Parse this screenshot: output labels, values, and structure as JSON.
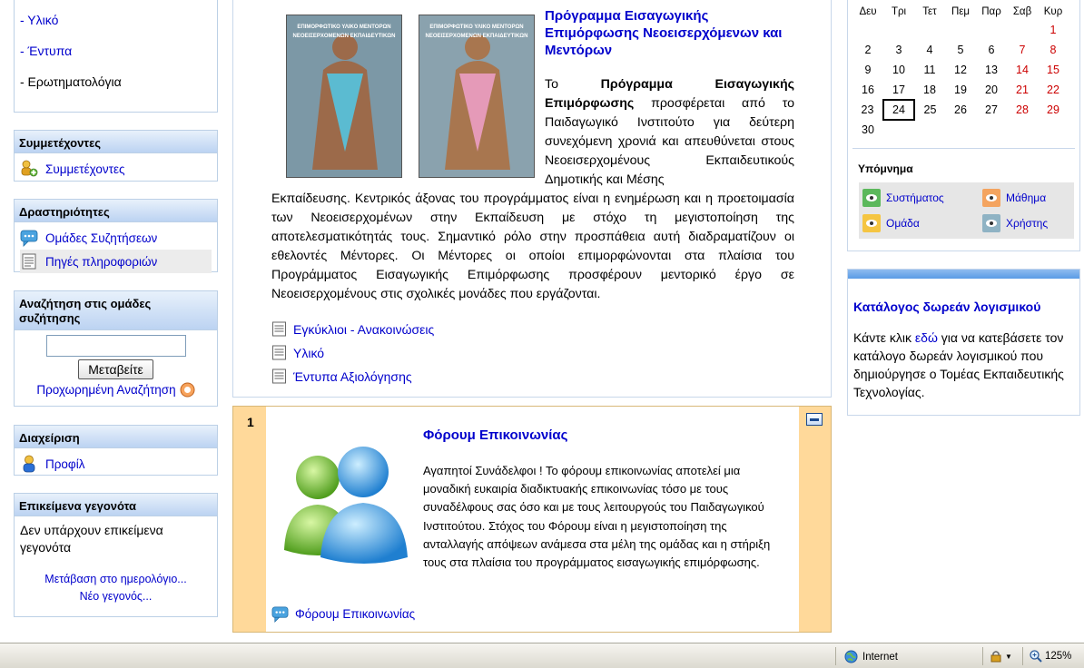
{
  "left": {
    "menu_items": [
      "- Υλικό",
      "- Έντυπα",
      "- Ερωτηματολόγια"
    ],
    "participants": {
      "title": "Συμμετέχοντες",
      "link": "Συμμετέχοντες"
    },
    "activities": {
      "title": "Δραστηριότητες",
      "items": [
        "Ομάδες Συζητήσεων",
        "Πηγές πληροφοριών"
      ]
    },
    "search": {
      "title": "Αναζήτηση στις ομάδες συζήτησης",
      "input_value": "",
      "button": "Μεταβείτε",
      "advanced": "Προχωρημένη Αναζήτηση"
    },
    "admin": {
      "title": "Διαχείριση",
      "profile": "Προφίλ"
    },
    "events": {
      "title": "Επικείμενα γεγονότα",
      "none": "Δεν υπάρχουν επικείμενα γεγονότα",
      "goto_calendar": "Μετάβαση στο ημερολόγιο...",
      "new_event": "Νέο γεγονός..."
    }
  },
  "center": {
    "program": {
      "title": "Πρόγραμμα Εισαγωγικής Επιμόρφωσης Νεοεισερχόμενων και Μεντόρων",
      "poster_header": "ΕΠΙΜΟΡΦΩΤΙΚΟ ΥΛΙΚΟ ΜΕΝΤΟΡΩΝ ΝΕΟΕΙΣΕΡΧΟΜΕΝΩΝ ΕΚΠΑΙΔΕΥΤΙΚΩΝ",
      "text_intro": "Το ",
      "text_bold": "Πρόγραμμα Εισαγωγικής Επιμόρφωσης",
      "text_1": " προσφέρεται από το Παιδαγωγικό Ινστιτούτο για δεύτερη συνεχόμενη χρονιά και απευθύνεται στους Νεοεισερχομένους Εκπαιδευτικούς Δημοτικής και Μέσης",
      "text_2": "Εκπαίδευσης. Κεντρικός άξονας του προγράμματος είναι η ενημέρωση και η προετοιμασία των Νεοεισερχομένων στην Εκπαίδευση με στόχο τη μεγιστοποίηση της αποτελεσματικότητάς τους. Σημαντικό ρόλο στην προσπάθεια αυτή διαδραματίζουν οι εθελοντές Μέντορες. Οι Μέντορες οι οποίοι επιμορφώνονται στα πλαίσια του Προγράμματος Εισαγωγικής Επιμόρφωσης προσφέρουν μεντορικό έργο σε Νεοεισερχομένους στις σχολικές μονάδες που εργάζονται.",
      "resources": [
        "Εγκύκλιοι - Ανακοινώσεις",
        "Υλικό",
        "Έντυπα Αξιολόγησης"
      ]
    },
    "forum": {
      "number": "1",
      "title": "Φόρουμ Επικοινωνίας",
      "text": "Αγαπητοί Συνάδελφοι ! Το φόρουμ επικοινωνίας αποτελεί μια μοναδική ευκαιρία διαδικτυακής επικοινωνίας τόσο με τους συναδέλφους σας όσο και με τους λειτουργούς του Παιδαγωγικού Ινστιτούτου. Στόχος του Φόρουμ είναι η μεγιστοποίηση της ανταλλαγής απόψεων ανάμεσα στα μέλη της ομάδας και η στήριξη τους στα πλαίσια του προγράμματος εισαγωγικής επιμόρφωσης.",
      "link": "Φόρουμ Επικοινωνίας"
    }
  },
  "right": {
    "calendar": {
      "weekdays": [
        "Δευ",
        "Τρι",
        "Τετ",
        "Πεμ",
        "Παρ",
        "Σαβ",
        "Κυρ"
      ],
      "weeks": [
        [
          "",
          "",
          "",
          "",
          "",
          "",
          "1"
        ],
        [
          "2",
          "3",
          "4",
          "5",
          "6",
          "7",
          "8"
        ],
        [
          "9",
          "10",
          "11",
          "12",
          "13",
          "14",
          "15"
        ],
        [
          "16",
          "17",
          "18",
          "19",
          "20",
          "21",
          "22"
        ],
        [
          "23",
          "24",
          "25",
          "26",
          "27",
          "28",
          "29"
        ],
        [
          "30",
          "",
          "",
          "",
          "",
          "",
          ""
        ]
      ],
      "today": "24"
    },
    "legend": {
      "title": "Υπόμνημα",
      "system": "Συστήματος",
      "course": "Μάθημα",
      "group": "Ομάδα",
      "user": "Χρήστης"
    },
    "software": {
      "title": "Κατάλογος δωρεάν λογισμικού",
      "text_before": "Κάντε κλικ ",
      "link": "εδώ",
      "text_after": " για να κατεβάσετε τον κατάλογο δωρεάν λογισμικού που δημιούργησε ο Τομέας Εκπαιδευτικής Τεχνολογίας."
    }
  },
  "statusbar": {
    "zone": "Internet",
    "zoom": "125%"
  },
  "colors": {
    "block_header": "#bcd3f2",
    "link": "#0000cc",
    "forum_side": "#ffd99a",
    "weekend": "#cc0000"
  }
}
